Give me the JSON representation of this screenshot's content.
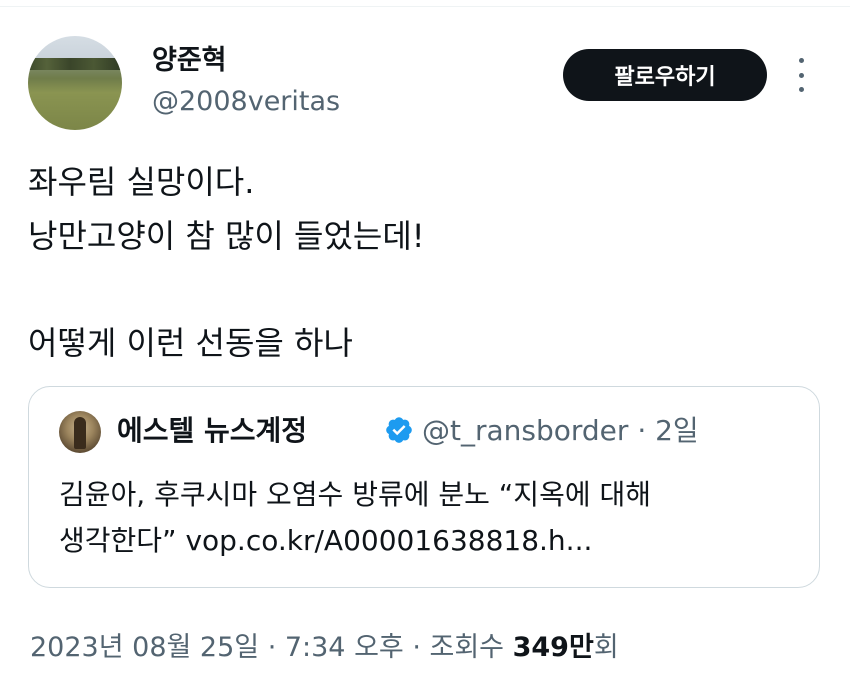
{
  "author": {
    "display_name": "양준혁",
    "handle": "@2008veritas"
  },
  "actions": {
    "follow_label": "팔로우하기",
    "more_icon": "more-vertical-icon"
  },
  "tweet": {
    "lines": [
      "좌우림 실망이다.",
      "낭만고양이 참 많이 들었는데!",
      "어떻게 이런 선동을 하나"
    ]
  },
  "quote": {
    "display_name": "에스텔 뉴스계정",
    "verified_icon": "verified-badge-icon",
    "handle_time": "@t_ransborder · 2일",
    "text_lines": [
      "김윤아, 후쿠시마 오염수 방류에 분노 “지옥에 대해",
      "생각한다” vop.co.kr/A00001638818.h..."
    ]
  },
  "meta": {
    "timestamp": "2023년 08월 25일 · 7:34 오후 · 조회수 ",
    "views_count": "349만",
    "views_suffix": "회"
  },
  "colors": {
    "text": "#0f1419",
    "secondary": "#536471",
    "border": "#cfd9de",
    "verified": "#1d9bf0",
    "button_bg": "#0f1419"
  }
}
